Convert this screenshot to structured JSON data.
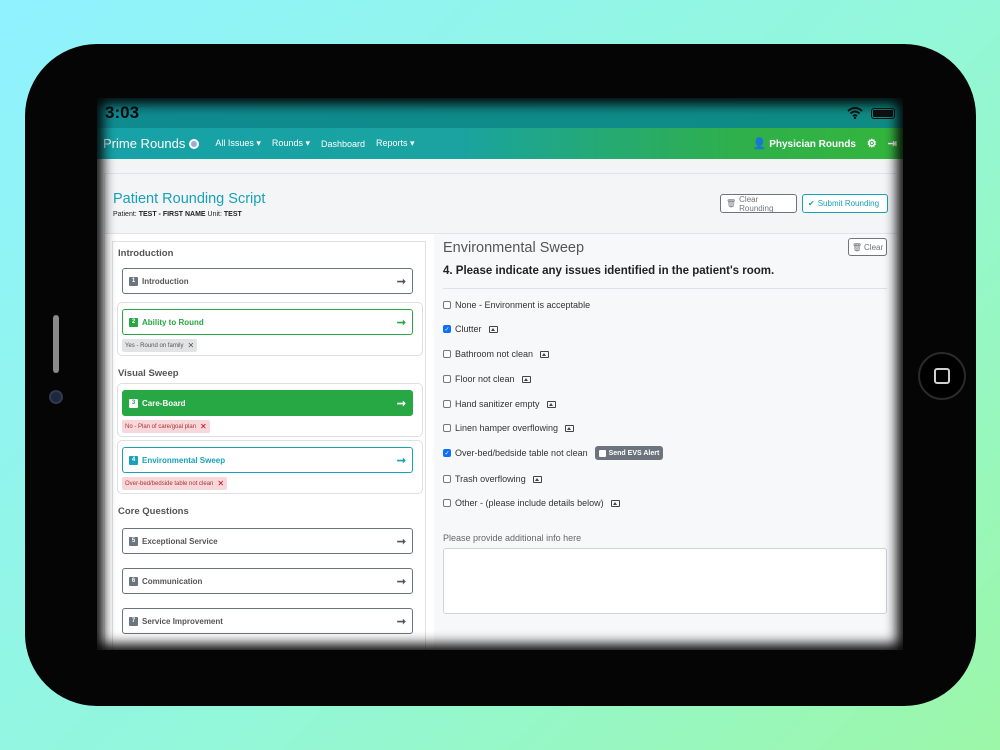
{
  "status_bar": {
    "time": "3:03",
    "icons": [
      "wifi-icon",
      "battery-icon"
    ]
  },
  "navbar": {
    "brand": "Prime Rounds",
    "links": [
      "All Issues",
      "Rounds",
      "Dashboard",
      "Reports"
    ],
    "physician": "Physician Rounds",
    "icons": [
      "user-icon",
      "gear-icon",
      "logout-icon"
    ]
  },
  "header": {
    "title": "Patient Rounding Script",
    "patient_label": "Patient:",
    "patient_name": "TEST - FIRST NAME",
    "unit_label": "Unit:",
    "unit_value": "TEST",
    "clear_rounding": "Clear Rounding",
    "submit_rounding": "Submit Rounding"
  },
  "sections": [
    {
      "title": "Introduction",
      "items": [
        {
          "num": "1",
          "label": "Introduction",
          "state": "default"
        },
        {
          "num": "2",
          "label": "Ability to Round",
          "state": "answered",
          "tag": "Yes - Round on family",
          "tag_style": "gray"
        }
      ]
    },
    {
      "title": "Visual Sweep",
      "items": [
        {
          "num": "3",
          "label": "Care-Board",
          "state": "active",
          "tag": "No - Plan of care/goal plan",
          "tag_style": "red"
        },
        {
          "num": "4",
          "label": "Environmental Sweep",
          "state": "current",
          "tag": "Over-bed/bedside table not clean",
          "tag_style": "red"
        }
      ]
    },
    {
      "title": "Core Questions",
      "items": [
        {
          "num": "5",
          "label": "Exceptional Service",
          "state": "default"
        },
        {
          "num": "6",
          "label": "Communication",
          "state": "default"
        },
        {
          "num": "7",
          "label": "Service Improvement",
          "state": "default"
        }
      ]
    }
  ],
  "sweep": {
    "title": "Environmental Sweep",
    "clear": "Clear",
    "question": "4. Please indicate any issues identified in the patient's room.",
    "options": [
      {
        "label": "None - Environment is acceptable",
        "checked": false,
        "image": false
      },
      {
        "label": "Clutter",
        "checked": true,
        "image": true
      },
      {
        "label": "Bathroom not clean",
        "checked": false,
        "image": true
      },
      {
        "label": "Floor not clean",
        "checked": false,
        "image": true
      },
      {
        "label": "Hand sanitizer empty",
        "checked": false,
        "image": true
      },
      {
        "label": "Linen hamper overflowing",
        "checked": false,
        "image": true
      },
      {
        "label": "Over-bed/bedside table not clean",
        "checked": true,
        "image": false,
        "alert": "Send EVS Alert"
      },
      {
        "label": "Trash overflowing",
        "checked": false,
        "image": true
      },
      {
        "label": "Other - (please include details below)",
        "checked": false,
        "image": true
      }
    ],
    "additional_info_label": "Please provide additional info here",
    "additional_info_value": ""
  }
}
